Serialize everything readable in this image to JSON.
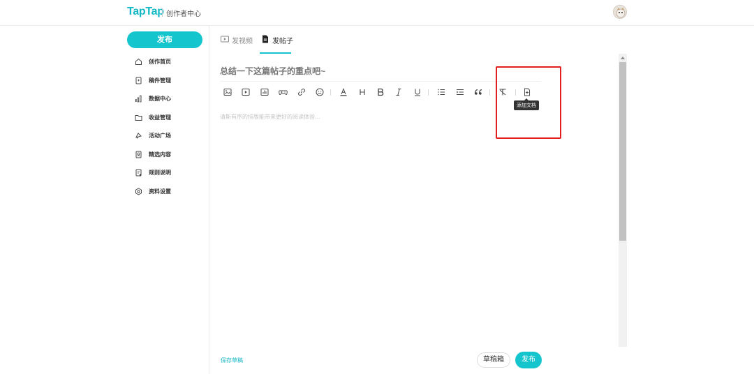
{
  "header": {
    "logo": "TapTap",
    "subtitle": "创作者中心"
  },
  "sidebar": {
    "publish_label": "发布",
    "items": [
      {
        "label": "创作首页",
        "icon": "home-icon"
      },
      {
        "label": "稿件管理",
        "icon": "document-icon"
      },
      {
        "label": "数据中心",
        "icon": "bar-chart-icon"
      },
      {
        "label": "收益管理",
        "icon": "folder-icon"
      },
      {
        "label": "活动广场",
        "icon": "megaphone-icon"
      },
      {
        "label": "精选内容",
        "icon": "award-icon"
      },
      {
        "label": "规则说明",
        "icon": "rules-icon"
      },
      {
        "label": "资料设置",
        "icon": "settings-icon"
      }
    ]
  },
  "tabs": [
    {
      "label": "发视频",
      "icon": "video-icon",
      "active": false
    },
    {
      "label": "发帖子",
      "icon": "post-icon",
      "active": true
    }
  ],
  "editor": {
    "title_placeholder": "总结一下这篇帖子的重点吧~",
    "body_placeholder": "请斯有序的排版能带来更好的阅读体验...",
    "toolbar": [
      "image-icon",
      "video-icon",
      "chart-icon",
      "gamepad-icon",
      "link-icon",
      "emoji-icon",
      "font-color-icon",
      "heading-icon",
      "bold-icon",
      "italic-icon",
      "underline-icon",
      "ordered-list-icon",
      "unordered-list-icon",
      "quote-icon",
      "clear-format-icon",
      "add-document-icon"
    ],
    "tooltip": "添加文档"
  },
  "footer": {
    "save_draft": "保存草稿",
    "drafts": "草稿箱",
    "publish": "发布"
  },
  "colors": {
    "accent": "#15c5ce",
    "highlight": "#e21f1f"
  }
}
